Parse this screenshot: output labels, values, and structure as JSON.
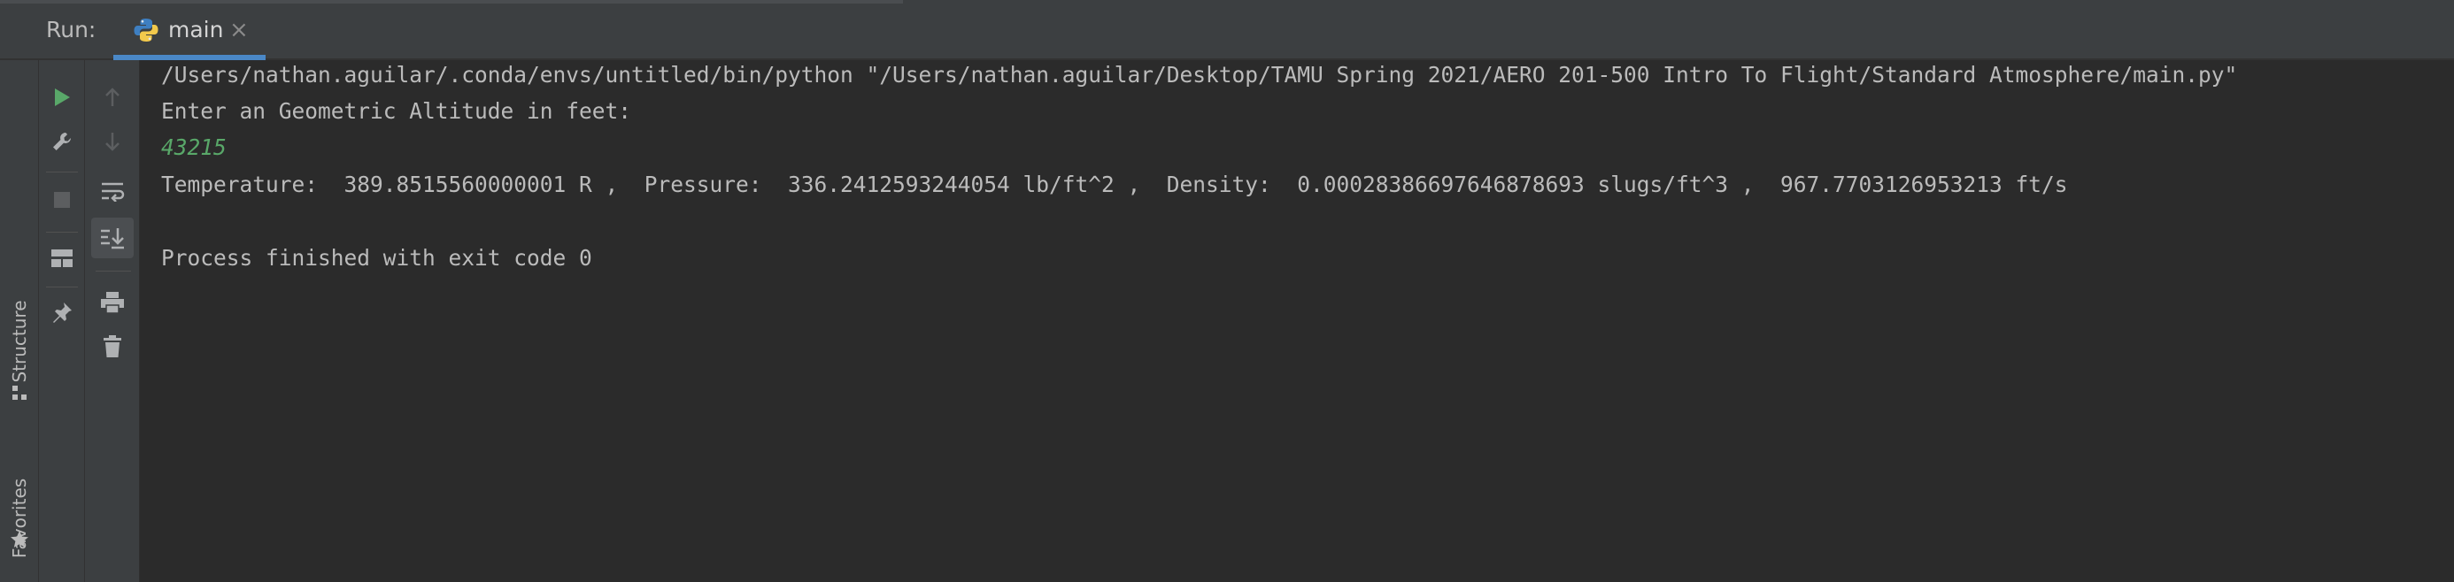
{
  "run_panel": {
    "label": "Run:",
    "tab": {
      "name": "main",
      "icon": "python-icon",
      "close_icon": "close-icon",
      "close_glyph": "×"
    }
  },
  "side_tool_windows": [
    {
      "label": "Structure",
      "icon": "structure-icon"
    },
    {
      "label": "Favorites",
      "icon": "star-icon"
    }
  ],
  "toolbar_left": [
    {
      "name": "rerun-button",
      "icon": "play-icon",
      "color": "#59a869"
    },
    {
      "name": "edit-config-button",
      "icon": "wrench-icon"
    },
    {
      "name": "stop-button",
      "icon": "stop-icon",
      "disabled": true
    },
    {
      "name": "restore-layout-button",
      "icon": "layout-icon"
    },
    {
      "name": "pin-tab-button",
      "icon": "pin-icon"
    }
  ],
  "toolbar_right": [
    {
      "name": "up-trace-button",
      "icon": "arrow-up-icon",
      "disabled": true
    },
    {
      "name": "down-trace-button",
      "icon": "arrow-down-icon",
      "disabled": true
    },
    {
      "name": "soft-wrap-button",
      "icon": "soft-wrap-icon"
    },
    {
      "name": "scroll-to-end-button",
      "icon": "scroll-to-end-icon",
      "active": true
    },
    {
      "name": "print-button",
      "icon": "printer-icon"
    },
    {
      "name": "clear-all-button",
      "icon": "trash-icon"
    }
  ],
  "console": {
    "lines": [
      "/Users/nathan.aguilar/.conda/envs/untitled/bin/python \"/Users/nathan.aguilar/Desktop/TAMU Spring 2021/AERO 201-500 Intro To Flight/Standard Atmosphere/main.py\"",
      "Enter an Geometric Altitude in feet:",
      "43215",
      "Temperature:  389.8515560000001 R ,  Pressure:  336.2412593244054 lb/ft^2 ,  Density:  0.00028386697646878693 slugs/ft^3 ,  967.7703126953213 ft/s",
      "",
      "Process finished with exit code 0"
    ],
    "input_line_color": "#59a869",
    "text_color": "#bbbbbb"
  }
}
